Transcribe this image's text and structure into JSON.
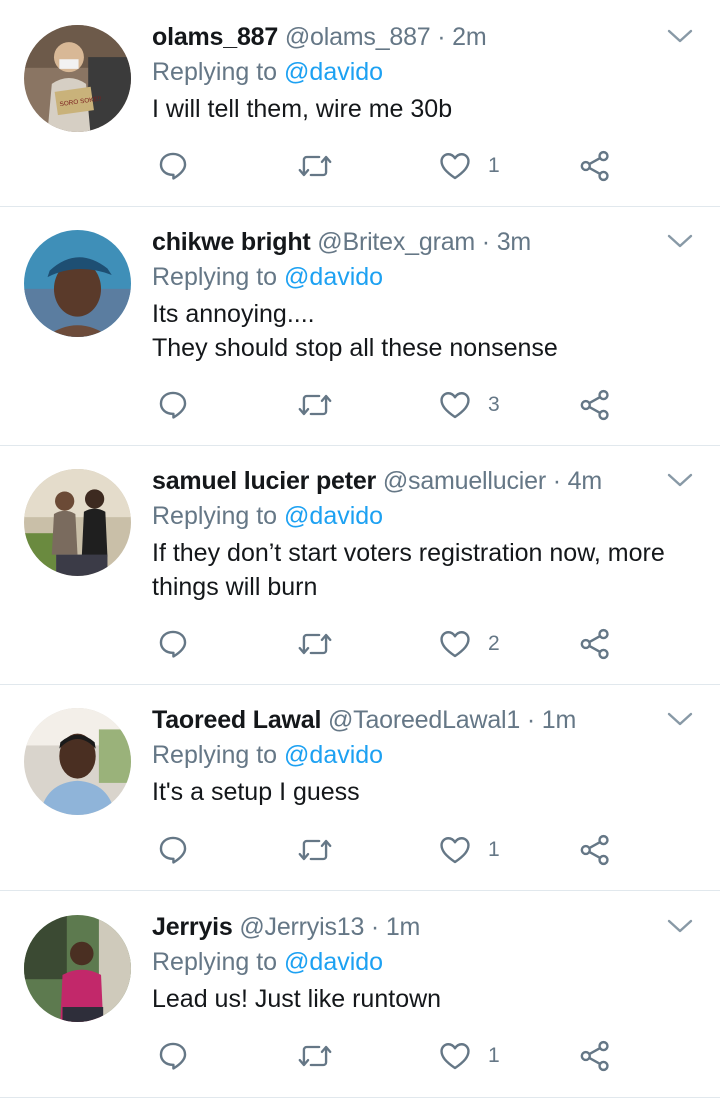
{
  "tweets": [
    {
      "name": "olams_887",
      "handle": "@olams_887",
      "time": "2m",
      "replying_prefix": "Replying to",
      "replying_to": "@davido",
      "text_lines": [
        "I will tell them, wire me 30b",
        ""
      ],
      "like_count": "1",
      "avatar_sign_text": "SORO SOKE!!"
    },
    {
      "name": "chikwe bright",
      "handle": "@Britex_gram",
      "time": "3m",
      "replying_prefix": "Replying to",
      "replying_to": "@davido",
      "text_lines": [
        "Its annoying....",
        "They should stop all these nonsense"
      ],
      "like_count": "3"
    },
    {
      "name": "samuel lucier peter",
      "handle": "@samuellucier",
      "time": "4m",
      "replying_prefix": "Replying to",
      "replying_to": "@davido",
      "text_lines": [
        "If they don’t start voters registration now, more",
        "things will burn"
      ],
      "like_count": "2"
    },
    {
      "name": "Taoreed Lawal",
      "handle": "@TaoreedLawal1",
      "time": "1m",
      "replying_prefix": "Replying to",
      "replying_to": "@davido",
      "text_lines": [
        "It's a setup I guess",
        ""
      ],
      "like_count": "1"
    },
    {
      "name": "Jerryis",
      "handle": "@Jerryis13",
      "time": "1m",
      "replying_prefix": "Replying to",
      "replying_to": "@davido",
      "text_lines": [
        "Lead us! Just like runtown",
        ""
      ],
      "like_count": "1"
    }
  ],
  "separator": "·",
  "icons": {
    "reply": "reply-icon",
    "retweet": "retweet-icon",
    "like": "heart-icon",
    "share": "share-icon",
    "more": "chevron-down-icon"
  },
  "colors": {
    "text": "#14171a",
    "secondary": "#657786",
    "link": "#1da1f2",
    "divider": "#e1e8ed"
  }
}
